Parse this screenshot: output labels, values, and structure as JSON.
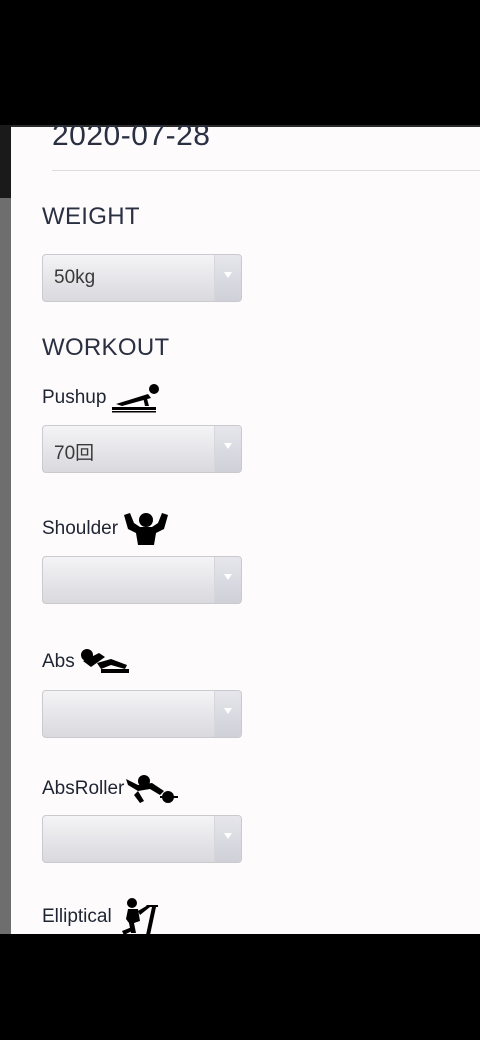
{
  "header": {
    "date": "2020-07-28"
  },
  "weight": {
    "title": "WEIGHT",
    "selected": "50kg"
  },
  "workout": {
    "title": "WORKOUT",
    "items": [
      {
        "label": "Pushup",
        "icon": "pushup-icon",
        "selected": "70回"
      },
      {
        "label": "Shoulder",
        "icon": "shoulder-icon",
        "selected": ""
      },
      {
        "label": "Abs",
        "icon": "situp-icon",
        "selected": ""
      },
      {
        "label": "AbsRoller",
        "icon": "ab-roller-icon",
        "selected": ""
      },
      {
        "label": "Elliptical",
        "icon": "elliptical-icon",
        "selected": ""
      }
    ]
  },
  "colors": {
    "background": "#fdfbfc",
    "text": "#2a3042",
    "select_top": "#f4f4f6",
    "select_bottom": "#d9d9de"
  }
}
